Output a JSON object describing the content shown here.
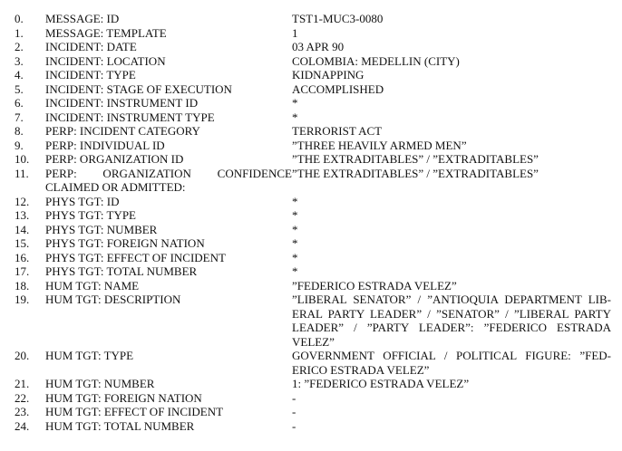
{
  "rows": [
    {
      "num": "0.",
      "label": "MESSAGE: ID",
      "value": "TST1-MUC3-0080"
    },
    {
      "num": "1.",
      "label": "MESSAGE: TEMPLATE",
      "value": "1"
    },
    {
      "num": "2.",
      "label": "INCIDENT: DATE",
      "value": "03 APR 90"
    },
    {
      "num": "3.",
      "label": "INCIDENT: LOCATION",
      "value": "COLOMBIA: MEDELLIN (CITY)"
    },
    {
      "num": "4.",
      "label": "INCIDENT: TYPE",
      "value": "KIDNAPPING"
    },
    {
      "num": "5.",
      "label": "INCIDENT: STAGE OF EXECUTION",
      "value": "ACCOMPLISHED"
    },
    {
      "num": "6.",
      "label": "INCIDENT: INSTRUMENT ID",
      "value": "*"
    },
    {
      "num": "7.",
      "label": "INCIDENT: INSTRUMENT TYPE",
      "value": "*"
    },
    {
      "num": "8.",
      "label": "PERP: INCIDENT CATEGORY",
      "value": "TERRORIST ACT"
    },
    {
      "num": "9.",
      "label": "PERP: INDIVIDUAL ID",
      "value": "”THREE HEAVILY ARMED MEN”"
    },
    {
      "num": "10.",
      "label": "PERP: ORGANIZATION ID",
      "value": "”THE EXTRADITABLES” / ”EXTRADITABLES”"
    },
    {
      "num": "11.",
      "label": "PERP: ORGANIZATION CONFIDENCE CLAIMED OR ADMITTED:",
      "value": "”THE EXTRADITABLES” / ”EXTRADITABLES”"
    },
    {
      "num": "12.",
      "label": "PHYS TGT: ID",
      "value": "*"
    },
    {
      "num": "13.",
      "label": "PHYS TGT: TYPE",
      "value": "*"
    },
    {
      "num": "14.",
      "label": "PHYS TGT: NUMBER",
      "value": "*"
    },
    {
      "num": "15.",
      "label": "PHYS TGT: FOREIGN NATION",
      "value": "*"
    },
    {
      "num": "16.",
      "label": "PHYS TGT: EFFECT OF INCIDENT",
      "value": "*"
    },
    {
      "num": "17.",
      "label": "PHYS TGT: TOTAL NUMBER",
      "value": "*"
    },
    {
      "num": "18.",
      "label": "HUM TGT: NAME",
      "value": "”FEDERICO ESTRADA VELEZ”"
    },
    {
      "num": "19.",
      "label": "HUM TGT: DESCRIPTION",
      "value": "”LIBERAL SENATOR” / ”ANTIOQUIA DEPARTMENT LIB-ERAL PARTY LEADER” / ”SENATOR” / ”LIBERAL PARTY LEADER” / ”PARTY LEADER”: ”FEDERICO ESTRADA VELEZ”"
    },
    {
      "num": "20.",
      "label": "HUM TGT: TYPE",
      "value": "GOVERNMENT OFFICIAL / POLITICAL FIGURE: ”FED-ERICO ESTRADA VELEZ”"
    },
    {
      "num": "21.",
      "label": "HUM TGT: NUMBER",
      "value": "1: ”FEDERICO ESTRADA VELEZ”"
    },
    {
      "num": "22.",
      "label": "HUM TGT: FOREIGN NATION",
      "value": "-"
    },
    {
      "num": "23.",
      "label": "HUM TGT: EFFECT OF INCIDENT",
      "value": "-"
    },
    {
      "num": "24.",
      "label": "HUM TGT: TOTAL NUMBER",
      "value": "-"
    }
  ]
}
